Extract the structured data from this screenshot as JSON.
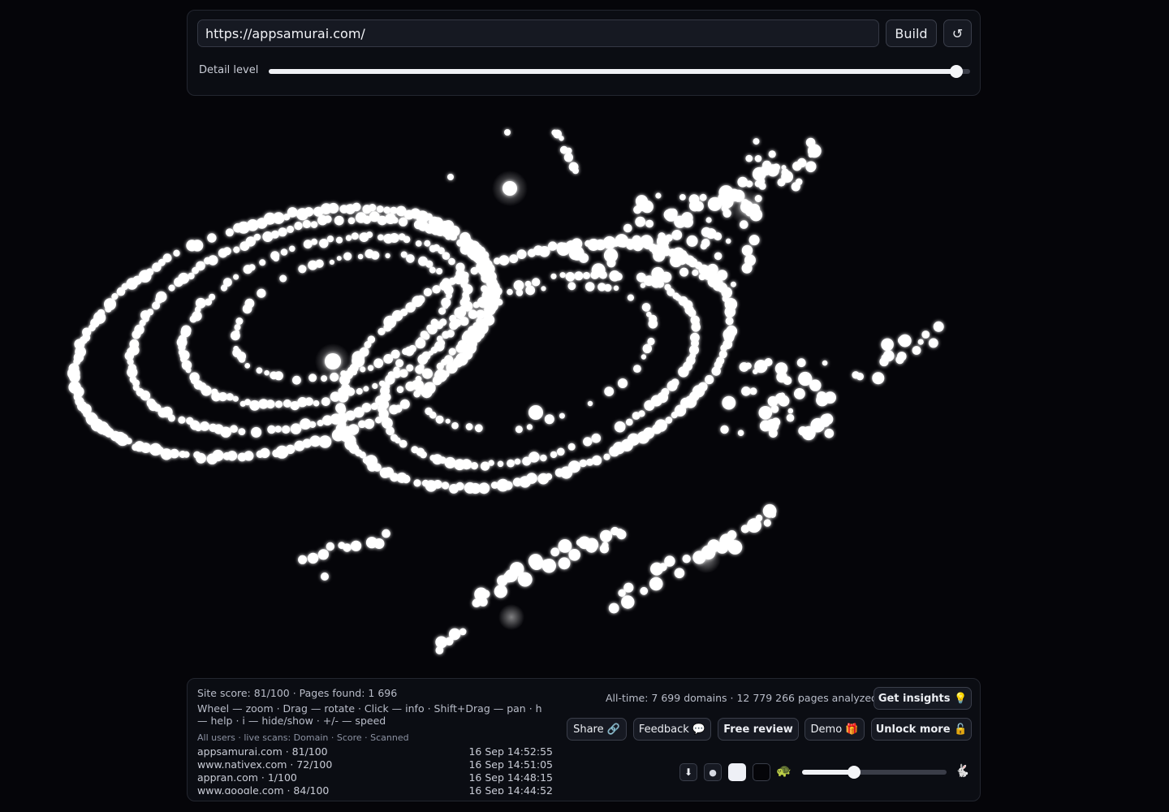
{
  "top_bar": {
    "url_value": "https://appsamurai.com/",
    "build_label": "Build",
    "reload_glyph": "↺",
    "detail_label": "Detail level",
    "detail_level": 0.98
  },
  "stats": {
    "site_line": "Site score: 81/100 · Pages found: 1 696",
    "help_line": "Wheel — zoom · Drag — rotate · Click — info · Shift+Drag — pan · h — help · i — hide/show · +/- — speed",
    "users_header": "All users · live scans: Domain · Score · Scanned",
    "scans": [
      {
        "domain": "appsamurai.com · 81/100",
        "time": "16 Sep 14:52:55"
      },
      {
        "domain": "www.nativex.com · 72/100",
        "time": "16 Sep 14:51:05"
      },
      {
        "domain": "appran.com · 1/100",
        "time": "16 Sep 14:48:15"
      },
      {
        "domain": "www.google.com · 84/100",
        "time": "16 Sep 14:44:52"
      }
    ],
    "alltime": "All-time: 7 699 domains · 12 779 266 pages analyzed"
  },
  "actions": {
    "insights": "Get insights 💡",
    "share": "Share 🔗",
    "feedback": "Feedback 💬",
    "review": "Free review",
    "demo": "Demo 🎁",
    "unlock": "Unlock more 🔓"
  },
  "controls": {
    "download_icon": "⬇",
    "dot_icon": "●",
    "turtle": "🐢",
    "rabbit": "🐇",
    "speed_level": 0.36
  },
  "colors": {
    "background": "#050509",
    "panel": "#0b0d13",
    "particle": "#ffffff"
  }
}
